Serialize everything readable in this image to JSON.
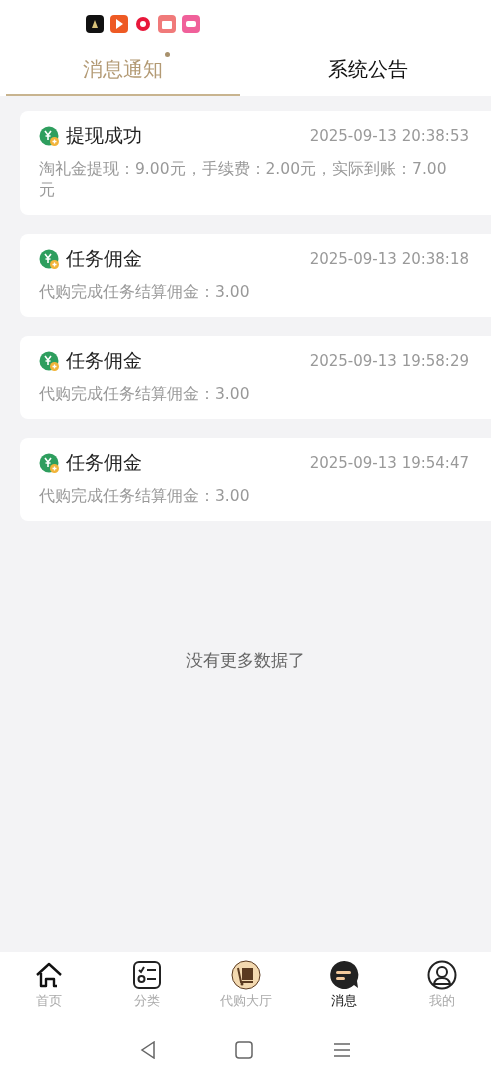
{
  "status_bar": {
    "notification_icons": [
      {
        "kind": "video",
        "color": "#111111"
      },
      {
        "kind": "play",
        "color": "#ee5a24"
      },
      {
        "kind": "ring",
        "color": "#e8173a"
      },
      {
        "kind": "calendar",
        "color": "#f07a7a"
      },
      {
        "kind": "chat",
        "color": "#f0609a"
      }
    ]
  },
  "tabs": [
    {
      "label": "消息通知",
      "selected": true,
      "unread_dot": true
    },
    {
      "label": "系统公告",
      "selected": false,
      "unread_dot": false
    }
  ],
  "messages": [
    {
      "title": "提现成功",
      "time": "2025-09-13 20:38:53",
      "body": "淘礼金提现：9.00元，手续费：2.00元，实际到账：7.00元"
    },
    {
      "title": "任务佣金",
      "time": "2025-09-13 20:38:18",
      "body": "代购完成任务结算佣金：3.00"
    },
    {
      "title": "任务佣金",
      "time": "2025-09-13 19:58:29",
      "body": "代购完成任务结算佣金：3.00"
    },
    {
      "title": "任务佣金",
      "time": "2025-09-13 19:54:47",
      "body": "代购完成任务结算佣金：3.00"
    }
  ],
  "end_note": "没有更多数据了",
  "bottom_nav": [
    {
      "label": "首页",
      "kind": "home",
      "selected": false
    },
    {
      "label": "分类",
      "kind": "category",
      "selected": false
    },
    {
      "label": "代购大厅",
      "kind": "hall",
      "selected": false
    },
    {
      "label": "消息",
      "kind": "message",
      "selected": true
    },
    {
      "label": "我的",
      "kind": "profile",
      "selected": false
    }
  ]
}
